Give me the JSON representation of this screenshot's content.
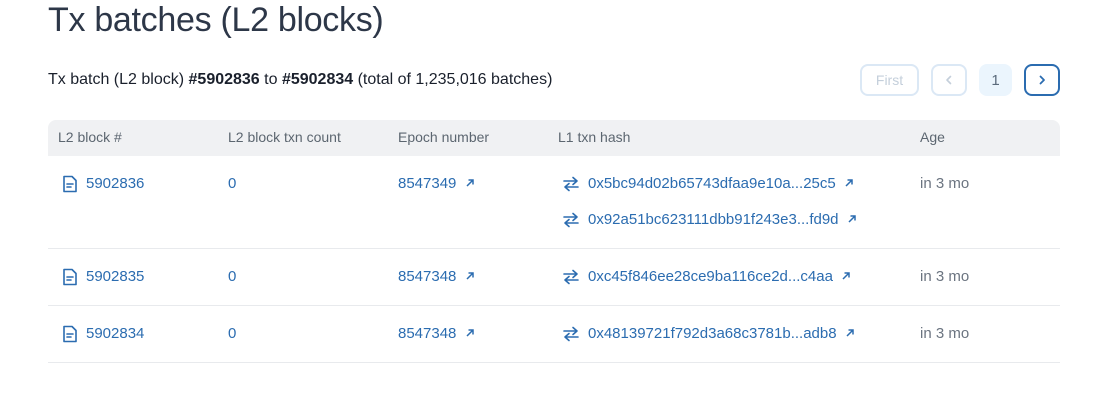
{
  "page": {
    "title": "Tx batches (L2 blocks)",
    "summary": {
      "prefix": "Tx batch (L2 block)",
      "from": "#5902836",
      "to_word": "to",
      "to": "#5902834",
      "total": "(total of 1,235,016 batches)"
    }
  },
  "pagination": {
    "first_label": "First",
    "current_page": "1"
  },
  "table": {
    "headers": {
      "block": "L2 block #",
      "txn_count": "L2 block txn count",
      "epoch": "Epoch number",
      "l1_hash": "L1 txn hash",
      "age": "Age"
    },
    "rows": [
      {
        "block": "5902836",
        "txn_count": "0",
        "epoch": "8547349",
        "hashes": [
          "0x5bc94d02b65743dfaa9e10a...25c5",
          "0x92a51bc623111dbb91f243e3...fd9d"
        ],
        "age": "in 3 mo"
      },
      {
        "block": "5902835",
        "txn_count": "0",
        "epoch": "8547348",
        "hashes": [
          "0xc45f846ee28ce9ba116ce2d...c4aa"
        ],
        "age": "in 3 mo"
      },
      {
        "block": "5902834",
        "txn_count": "0",
        "epoch": "8547348",
        "hashes": [
          "0x48139721f792d3a68c3781b...adb8"
        ],
        "age": "in 3 mo"
      }
    ]
  },
  "colors": {
    "link": "#2b6cb0",
    "header_bg": "#f0f1f3",
    "muted": "#6b7480"
  },
  "icons": {
    "block": "document-icon",
    "hash": "swap-arrows-icon",
    "external": "external-link-icon"
  }
}
